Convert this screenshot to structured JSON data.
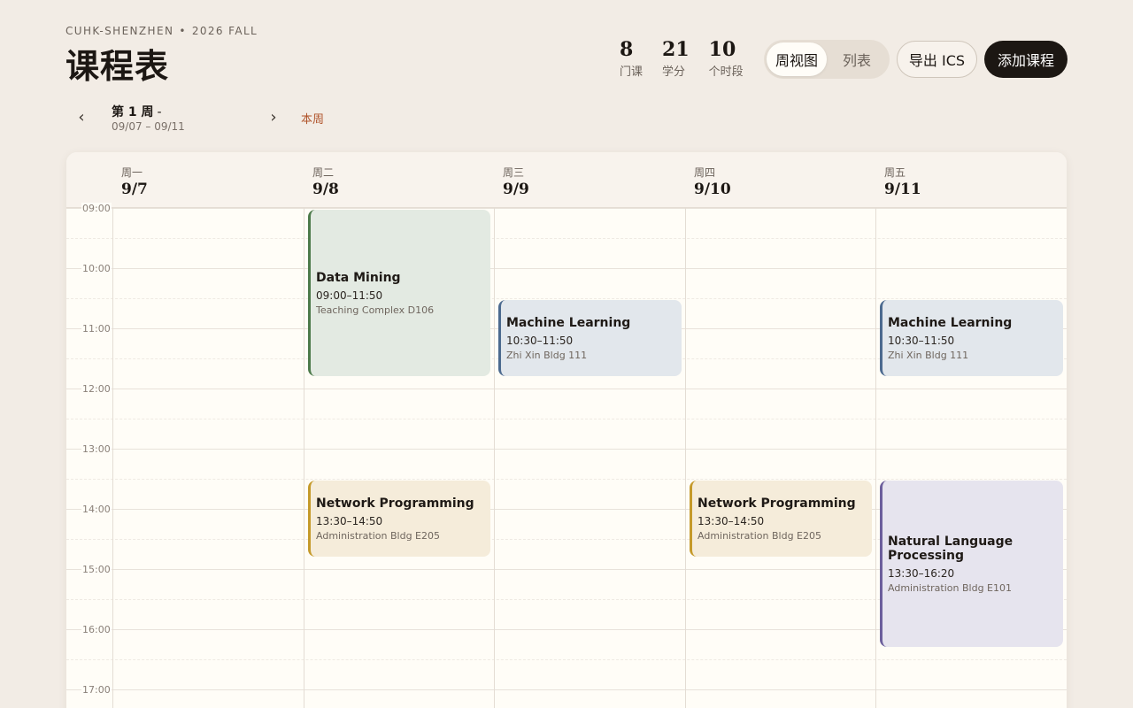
{
  "header": {
    "school": "CUHK-SHENZHEN",
    "separator": "•",
    "term": "2026 FALL",
    "title": "课程表"
  },
  "stats": [
    {
      "num": "8",
      "label": "门课"
    },
    {
      "num": "21",
      "label": "学分"
    },
    {
      "num": "10",
      "label": "个时段"
    }
  ],
  "view_toggle": {
    "week": "周视图",
    "list": "列表",
    "active": "week"
  },
  "buttons": {
    "export": "导出 ICS",
    "add": "添加课程"
  },
  "week_nav": {
    "prev": "‹",
    "next": "›",
    "title": "第 1 周",
    "dash": "-",
    "range": "09/07 – 09/11",
    "this_week": "本周"
  },
  "days": [
    {
      "name": "周一",
      "date": "9/7"
    },
    {
      "name": "周二",
      "date": "9/8"
    },
    {
      "name": "周三",
      "date": "9/9"
    },
    {
      "name": "周四",
      "date": "9/10"
    },
    {
      "name": "周五",
      "date": "9/11"
    }
  ],
  "hours": [
    "09:00",
    "10:00",
    "11:00",
    "12:00",
    "13:00",
    "14:00",
    "15:00",
    "16:00",
    "17:00"
  ],
  "events": [
    {
      "day": 1,
      "name": "Data Mining",
      "time": "09:00–11:50",
      "location": "Teaching Complex D106",
      "color": "green"
    },
    {
      "day": 2,
      "name": "Machine Learning",
      "time": "10:30–11:50",
      "location": "Zhi Xin Bldg 111",
      "color": "blue"
    },
    {
      "day": 4,
      "name": "Machine Learning",
      "time": "10:30–11:50",
      "location": "Zhi Xin Bldg 111",
      "color": "blue"
    },
    {
      "day": 1,
      "name": "Network Programming",
      "time": "13:30–14:50",
      "location": "Administration Bldg E205",
      "color": "yellow"
    },
    {
      "day": 3,
      "name": "Network Programming",
      "time": "13:30–14:50",
      "location": "Administration Bldg E205",
      "color": "yellow"
    },
    {
      "day": 4,
      "name": "Natural Language Processing",
      "time": "13:30–16:20",
      "location": "Administration Bldg E101",
      "color": "purple"
    }
  ]
}
